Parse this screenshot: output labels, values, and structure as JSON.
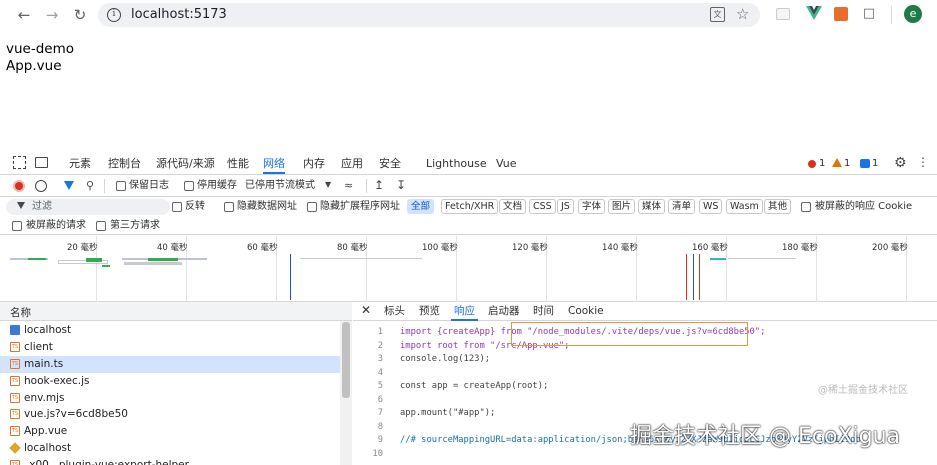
{
  "browser": {
    "url": "localhost:5173",
    "avatar_letter": "e",
    "icons": [
      "back-icon",
      "forward-icon",
      "reload-icon",
      "site-info-icon",
      "translate-icon",
      "star-icon",
      "extension-icon",
      "vue-devtools-icon",
      "extension-orange-icon",
      "puzzle-icon"
    ]
  },
  "page": {
    "line1": "vue-demo",
    "line2": "App.vue"
  },
  "devtools": {
    "tabs": [
      {
        "label": "元素"
      },
      {
        "label": "控制台"
      },
      {
        "label": "源代码/来源"
      },
      {
        "label": "性能"
      },
      {
        "label": "网络",
        "active": true
      },
      {
        "label": "内存"
      },
      {
        "label": "应用"
      },
      {
        "label": "安全"
      },
      {
        "label": "Lighthouse"
      },
      {
        "label": "Vue"
      }
    ],
    "counts": {
      "errors": "1",
      "warnings": "1",
      "info": "1"
    },
    "toolbar": {
      "preserve_log": "保留日志",
      "disable_cache": "停用缓存",
      "throttle": "已停用节流模式"
    },
    "filter": {
      "placeholder": "过滤",
      "invert": "反转",
      "hide_data_urls": "隐藏数据网址",
      "hide_ext_urls": "隐藏扩展程序网址",
      "types": [
        "全部",
        "Fetch/XHR",
        "文档",
        "CSS",
        "JS",
        "字体",
        "图片",
        "媒体",
        "清单",
        "WS",
        "Wasm",
        "其他"
      ],
      "blocked_cookies": "被屏蔽的响应 Cookie",
      "blocked_requests": "被屏蔽的请求",
      "third_party": "第三方请求"
    },
    "timeline": {
      "ticks": [
        "20 毫秒",
        "40 毫秒",
        "60 毫秒",
        "80 毫秒",
        "100 毫秒",
        "120 毫秒",
        "140 毫秒",
        "160 毫秒",
        "180 毫秒",
        "200 毫秒"
      ]
    },
    "requests": {
      "header": "名称",
      "rows": [
        {
          "name": "localhost",
          "type": "doc"
        },
        {
          "name": "client",
          "type": "ts"
        },
        {
          "name": "main.ts",
          "type": "ts",
          "selected": true
        },
        {
          "name": "hook-exec.js",
          "type": "ts"
        },
        {
          "name": "env.mjs",
          "type": "ts"
        },
        {
          "name": "vue.js?v=6cd8be50",
          "type": "ts"
        },
        {
          "name": "App.vue",
          "type": "ts"
        },
        {
          "name": "localhost",
          "type": "js"
        },
        {
          "name": "_x00...plugin-vue:export-helper",
          "type": "ts"
        }
      ]
    },
    "detail": {
      "tabs": [
        "标头",
        "预览",
        "响应",
        "启动器",
        "时间",
        "Cookie"
      ],
      "active_tab": "响应",
      "code_lines": [
        "import {createApp} from \"/node_modules/.vite/deps/vue.js?v=6cd8be50\";",
        "import root from \"/src/App.vue\";",
        "console.log(123);",
        "",
        "const app = createApp(root);",
        "",
        "app.mount(\"#app\");",
        "",
        "//# sourceMappingURL=data:application/json;base64,eyJ2ZXJzaW9uIjozLCJzb3VyY2VzIjpbIi9ob",
        ""
      ]
    }
  },
  "watermark": {
    "main": "掘金技术社区 @ EcoXigua",
    "secondary": "@稀土掘金技术社区"
  }
}
